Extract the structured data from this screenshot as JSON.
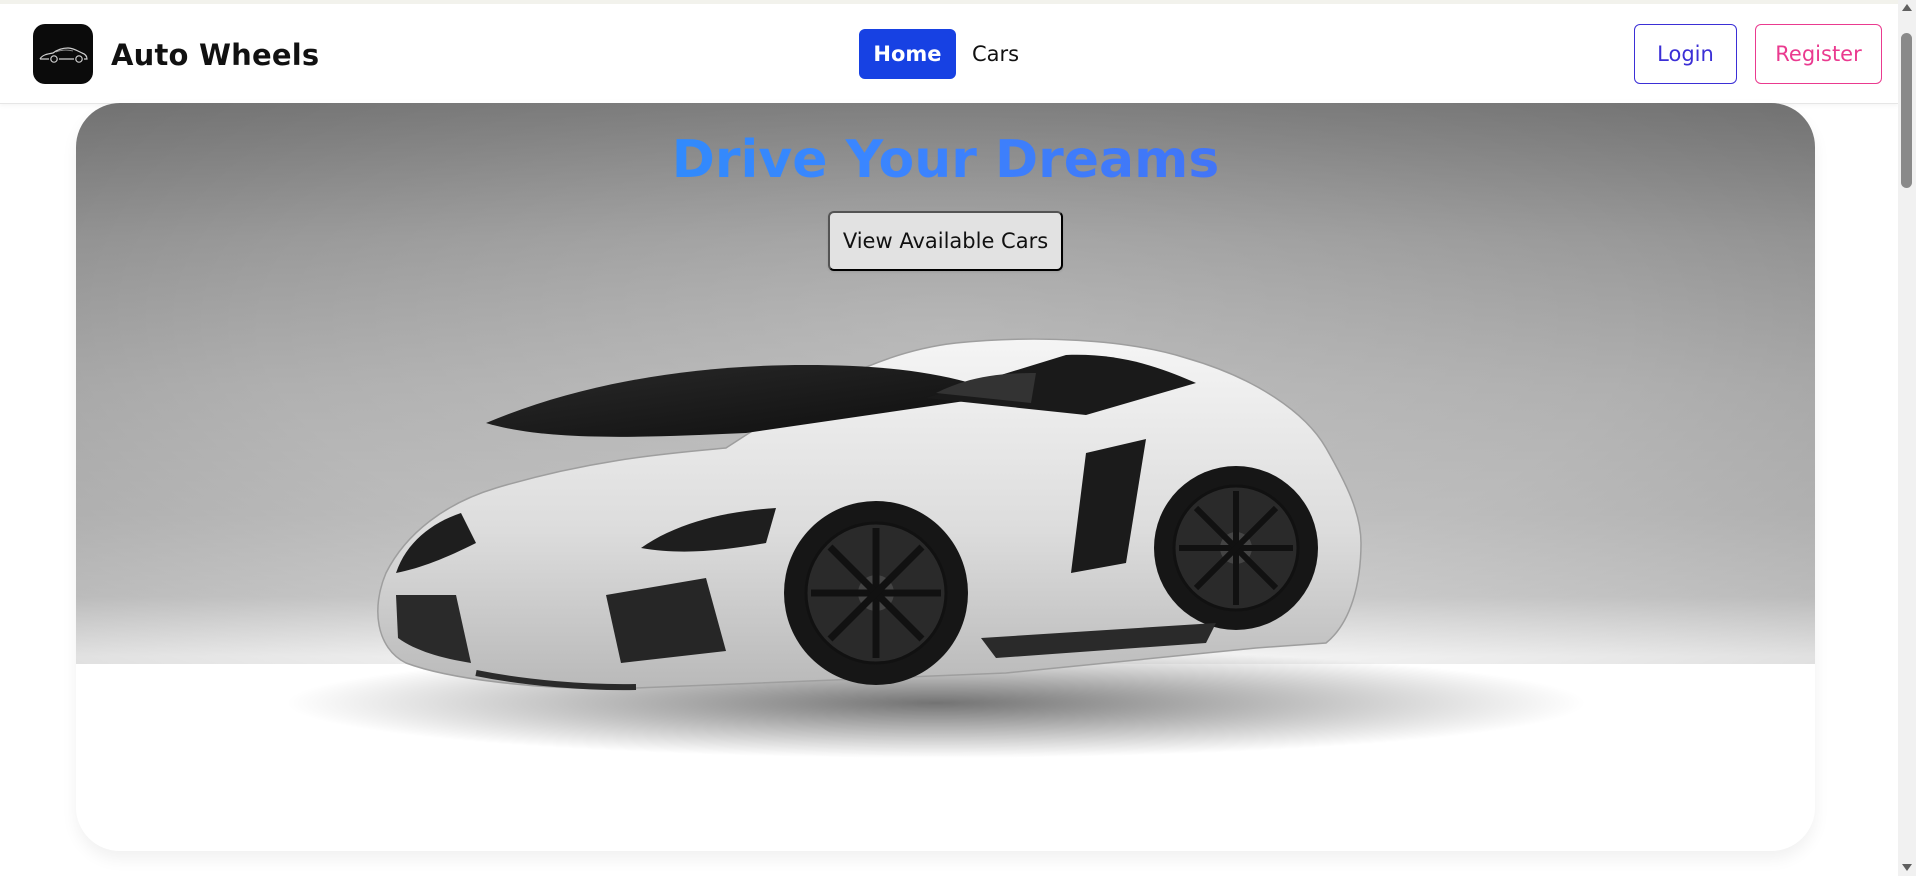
{
  "header": {
    "brand_name": "Auto Wheels",
    "logo_icon": "car-silhouette-icon",
    "nav": [
      {
        "label": "Home",
        "active": true
      },
      {
        "label": "Cars",
        "active": false
      }
    ],
    "login_label": "Login",
    "register_label": "Register"
  },
  "hero": {
    "title": "Drive Your Dreams",
    "cta_label": "View Available Cars",
    "image": "white-sports-car"
  },
  "colors": {
    "primary": "#1741e3",
    "login_accent": "#3b2fd6",
    "register_accent": "#ea3a8f",
    "title_gradient_start": "#1596f0",
    "title_gradient_end": "#4f58e8"
  }
}
